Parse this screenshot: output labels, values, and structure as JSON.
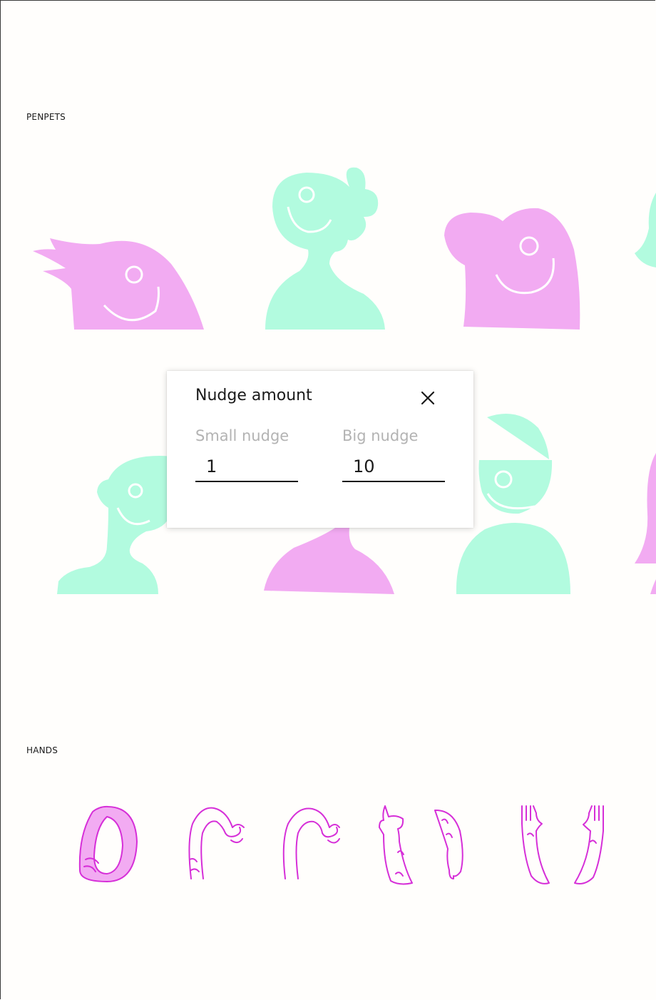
{
  "sections": {
    "penpets_label": "PENPETS",
    "hands_label": "HANDS"
  },
  "colors": {
    "mint": "#b2fbdf",
    "pink": "#f2abf2",
    "hand_stroke": "#d62fd8"
  },
  "dialog": {
    "title": "Nudge amount",
    "close_icon": "close-icon",
    "small_nudge": {
      "label": "Small nudge",
      "value": "1"
    },
    "big_nudge": {
      "label": "Big nudge",
      "value": "10"
    }
  }
}
